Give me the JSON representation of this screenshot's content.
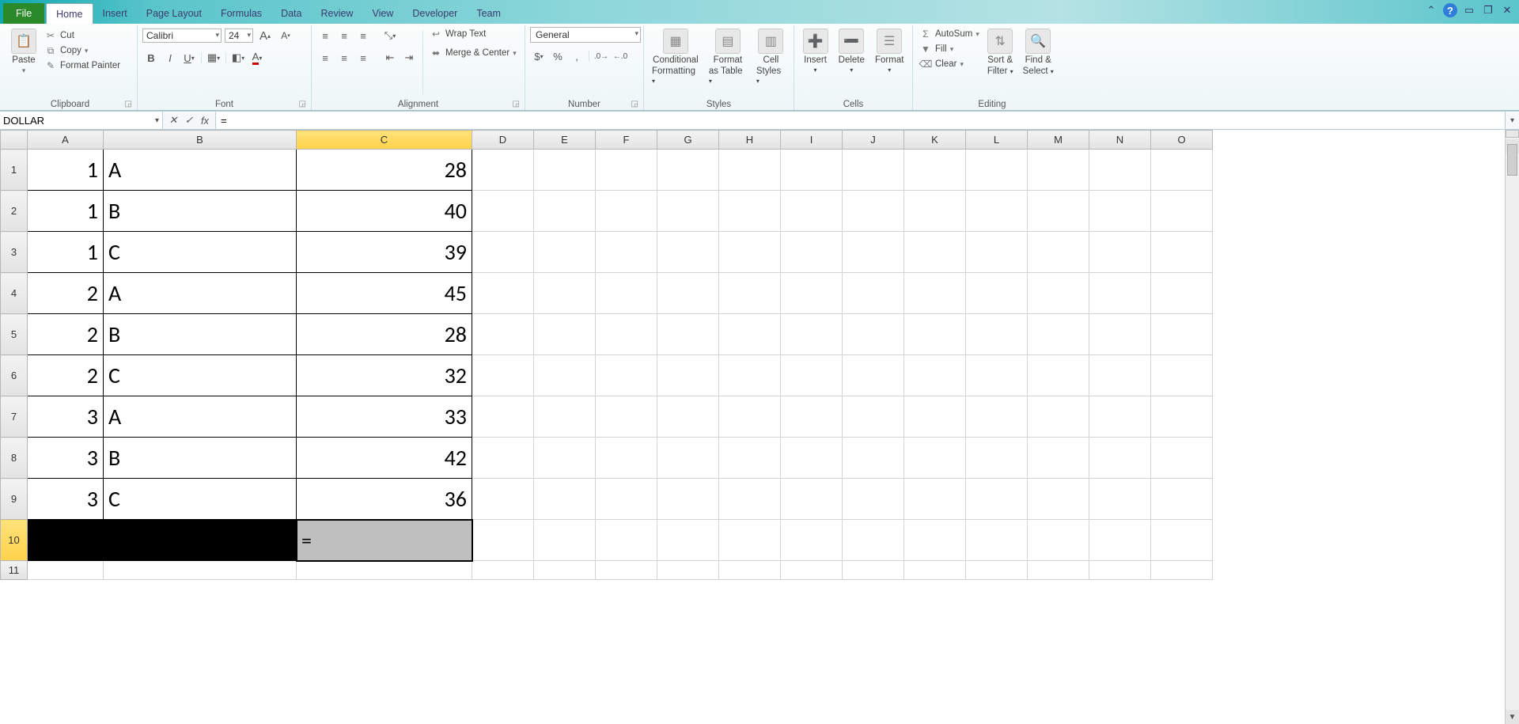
{
  "tabs": {
    "file": "File",
    "items": [
      "Home",
      "Insert",
      "Page Layout",
      "Formulas",
      "Data",
      "Review",
      "View",
      "Developer",
      "Team"
    ],
    "active": "Home"
  },
  "ribbon": {
    "clipboard": {
      "paste": "Paste",
      "cut": "Cut",
      "copy": "Copy",
      "painter": "Format Painter",
      "label": "Clipboard"
    },
    "font": {
      "name": "Calibri",
      "size": "24",
      "label": "Font"
    },
    "alignment": {
      "wrap": "Wrap Text",
      "merge": "Merge & Center",
      "label": "Alignment"
    },
    "number": {
      "format": "General",
      "label": "Number"
    },
    "styles": {
      "cond1": "Conditional",
      "cond2": "Formatting",
      "table1": "Format",
      "table2": "as Table",
      "cell1": "Cell",
      "cell2": "Styles",
      "label": "Styles"
    },
    "cells": {
      "insert": "Insert",
      "delete": "Delete",
      "format": "Format",
      "label": "Cells"
    },
    "editing": {
      "autosum": "AutoSum",
      "fill": "Fill",
      "clear": "Clear",
      "sort1": "Sort &",
      "sort2": "Filter",
      "find1": "Find &",
      "find2": "Select",
      "label": "Editing"
    }
  },
  "fxbar": {
    "name": "DOLLAR",
    "formula": "="
  },
  "columns": [
    "A",
    "B",
    "C",
    "D",
    "E",
    "F",
    "G",
    "H",
    "I",
    "J",
    "K",
    "L",
    "M",
    "N",
    "O"
  ],
  "colWidths": {
    "A": 96,
    "B": 244,
    "C": 222,
    "default": 78
  },
  "selectedCol": "C",
  "selectedRow": 10,
  "rowCount": 11,
  "dataRowHeight": 52,
  "cells": {
    "r1": {
      "A": "1",
      "B": "A",
      "C": "28"
    },
    "r2": {
      "A": "1",
      "B": "B",
      "C": "40"
    },
    "r3": {
      "A": "1",
      "B": "C",
      "C": "39"
    },
    "r4": {
      "A": "2",
      "B": "A",
      "C": "45"
    },
    "r5": {
      "A": "2",
      "B": "B",
      "C": "28"
    },
    "r6": {
      "A": "2",
      "B": "C",
      "C": "32"
    },
    "r7": {
      "A": "3",
      "B": "A",
      "C": "33"
    },
    "r8": {
      "A": "3",
      "B": "B",
      "C": "42"
    },
    "r9": {
      "A": "3",
      "B": "C",
      "C": "36"
    }
  },
  "editingCell": {
    "row": 10,
    "col": "C",
    "value": "="
  }
}
